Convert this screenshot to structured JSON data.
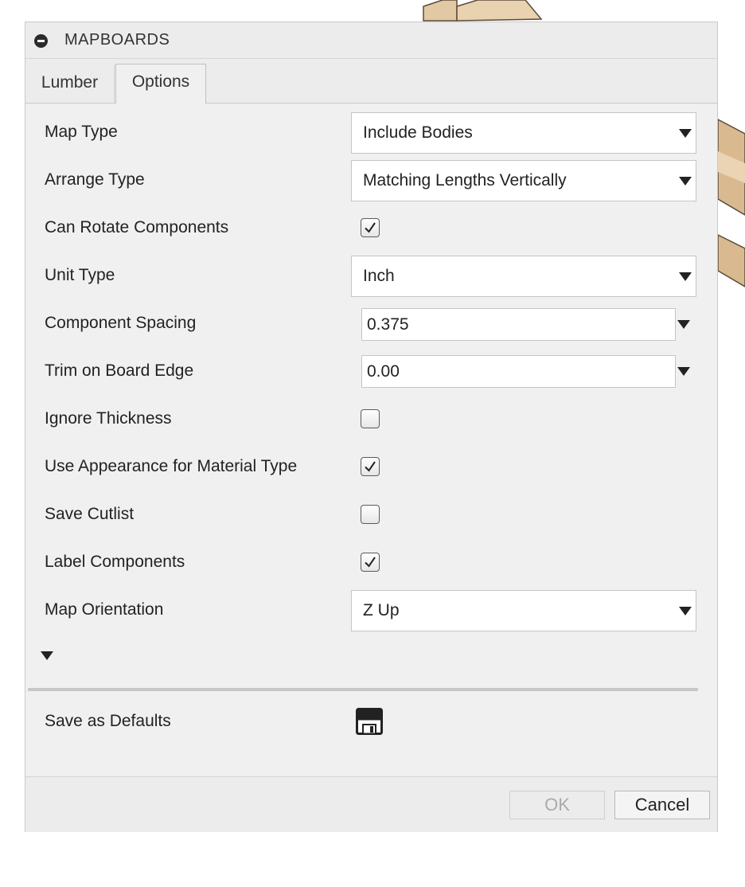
{
  "dialog": {
    "title": "MAPBOARDS"
  },
  "tabs": [
    {
      "label": "Lumber",
      "active": false
    },
    {
      "label": "Options",
      "active": true
    }
  ],
  "options": {
    "map_type": {
      "label": "Map Type",
      "value": "Include Bodies"
    },
    "arrange_type": {
      "label": "Arrange Type",
      "value": "Matching Lengths Vertically"
    },
    "can_rotate": {
      "label": "Can Rotate Components",
      "checked": true
    },
    "unit_type": {
      "label": "Unit Type",
      "value": "Inch"
    },
    "component_spacing": {
      "label": "Component Spacing",
      "value": "0.375"
    },
    "trim_edge": {
      "label": "Trim on Board Edge",
      "value": "0.00"
    },
    "ignore_thickness": {
      "label": "Ignore Thickness",
      "checked": false
    },
    "use_appearance": {
      "label": "Use Appearance for Material Type",
      "checked": true
    },
    "save_cutlist": {
      "label": "Save Cutlist",
      "checked": false
    },
    "label_components": {
      "label": "Label Components",
      "checked": true
    },
    "map_orientation": {
      "label": "Map Orientation",
      "value": "Z Up"
    }
  },
  "defaults": {
    "label": "Save as Defaults",
    "icon": "save-icon"
  },
  "footer": {
    "ok_label": "OK",
    "cancel_label": "Cancel"
  },
  "colors": {
    "panel": "#f0f0f0",
    "wood": "#e2c8a2"
  }
}
